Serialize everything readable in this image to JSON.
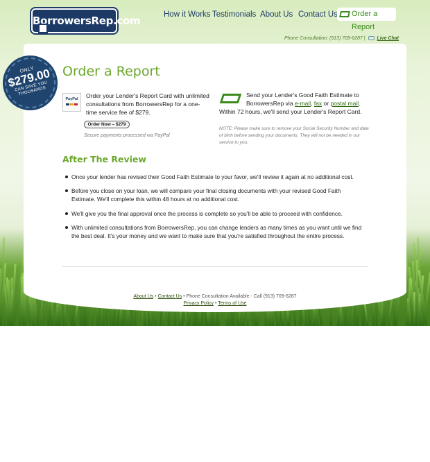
{
  "header": {
    "logo_text": "BorrowersRep.com",
    "nav": [
      "How it Works",
      "Testimonials",
      "About Us",
      "Contact Us"
    ],
    "order_cta": "Order a Report",
    "phone_bar": "Phone Consultation: (913) 709-6287 |",
    "live_chat": "Live Chat"
  },
  "badge": {
    "line1": "ONLY",
    "price": "$279.00",
    "line3": "CAN SAVE YOU",
    "line4": "THOUSANDS"
  },
  "main": {
    "title": "Order a Report",
    "col1_text": "Order your Lender's Report Card with unlimited consultations from BorrowersRep for a one-time service fee of $279.",
    "order_button": "Order Now – $279",
    "secure_note": "Secure payments processed via PayPal",
    "paypal_label": "PayPal",
    "col2_prefix": "Send your Lender's Good Faith Estimate to BorrowersRep via",
    "col2_email": "e-mail",
    "col2_fax": "fax",
    "col2_or": "or",
    "col2_postal": "postal mail",
    "col2_suffix": "Within 72 hours, we'll send your Lender's Report Card.",
    "note": "NOTE: Please make sure to remove your Social Security Number and date of birth before sending your documents. They will not be needed in our service to you."
  },
  "review": {
    "title": "After The Review",
    "items": [
      "Once your lender has revised their Good Faith Estimate to your favor, we'll review it again at no additional cost.",
      "Before you close on your loan, we will compare your final closing documents with your revised Good Faith Estimate. We'll complete this within 48 hours at no additional cost.",
      "We'll give you the final approval once the process is complete so you'll be able to proceed with confidence.",
      "With unlimited consultations from BorrowersRep, you can change lenders as many times as you want until we find the best deal. It's your money and we want to make sure that you're satisfied throughout the entire process."
    ]
  },
  "footer": {
    "about": "About Us",
    "contact": "Contact Us",
    "phone": "• Phone Consultation Available - Call (913) 709-6287",
    "privacy": "Privacy Policy",
    "terms": "Terms of Use"
  },
  "colors": {
    "brand_navy": "#1d3a66",
    "accent_green": "#6ba72b",
    "link_green": "#2f6a12"
  }
}
